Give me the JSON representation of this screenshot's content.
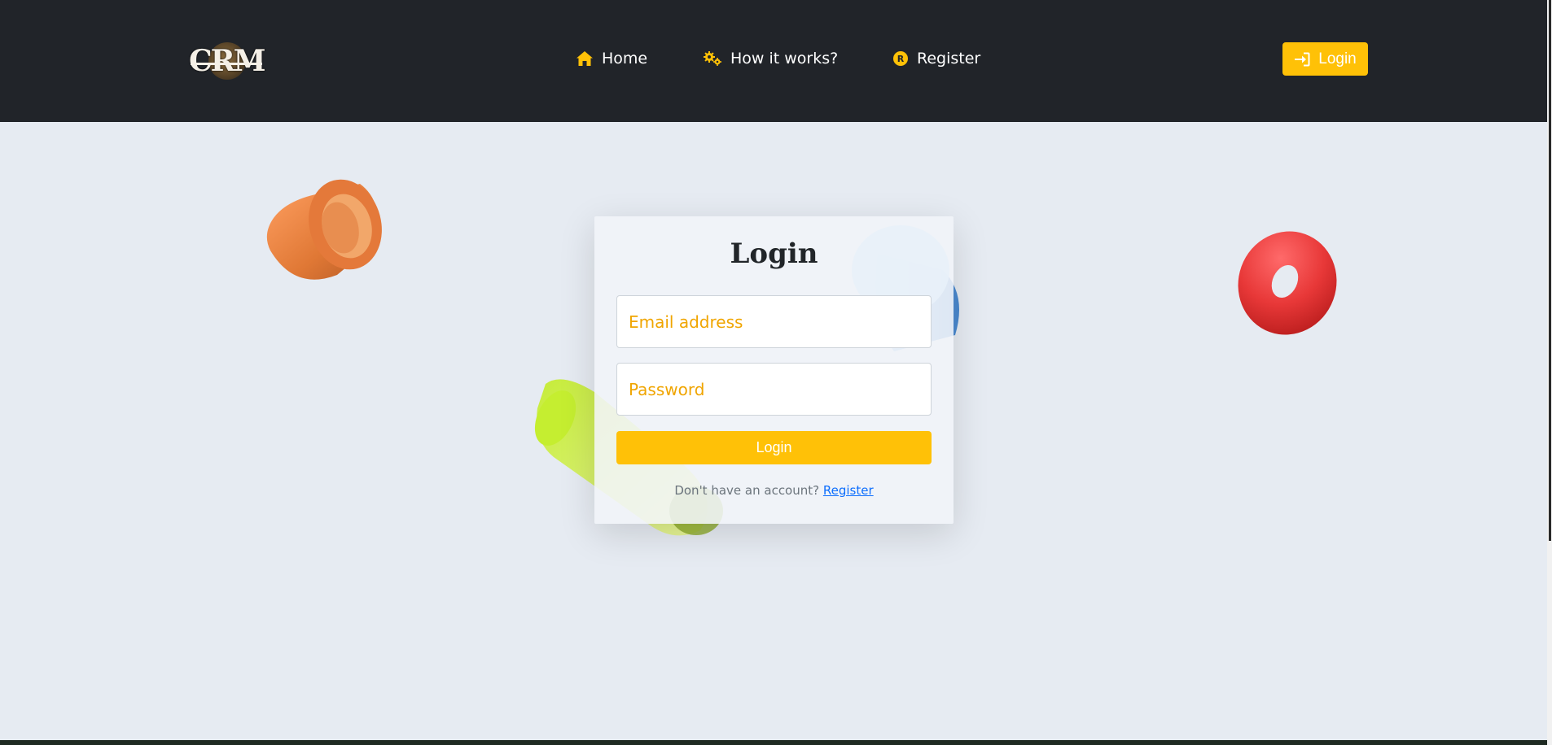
{
  "brand": {
    "logo_text": "CRM"
  },
  "nav": {
    "items": [
      {
        "label": "Home",
        "icon": "home-icon"
      },
      {
        "label": "How it works?",
        "icon": "gears-icon"
      },
      {
        "label": "Register",
        "icon": "r-circle-icon"
      }
    ],
    "login_button": {
      "label": "Login",
      "icon": "sign-in-icon"
    }
  },
  "login_card": {
    "title": "Login",
    "email_placeholder": "Email address",
    "email_value": "",
    "password_placeholder": "Password",
    "password_value": "",
    "submit_label": "Login",
    "signup_prompt": "Don't have an account?",
    "signup_link": "Register"
  },
  "colors": {
    "navbar": "#212429",
    "accent": "#ffc107",
    "placeholder": "#f0a500",
    "background": "#e6ebf2",
    "link": "#0d6efd"
  }
}
